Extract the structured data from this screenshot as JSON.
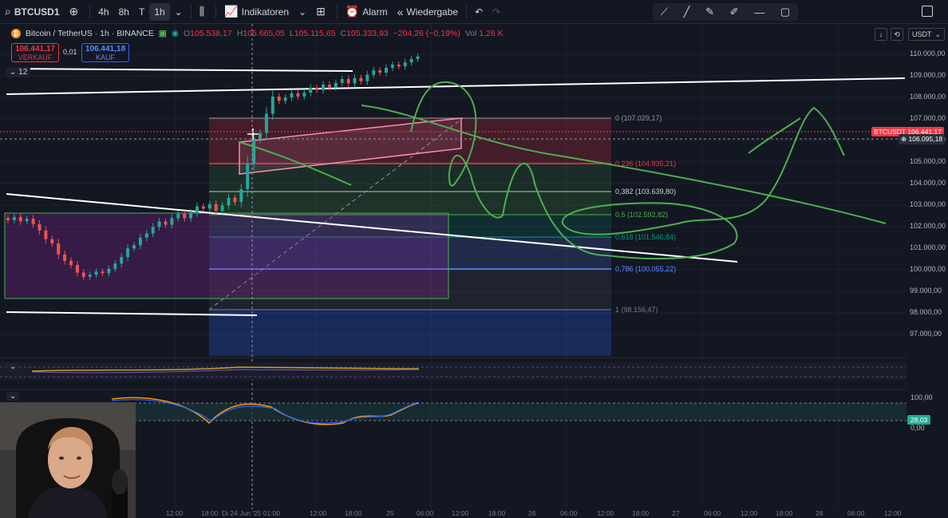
{
  "toolbar": {
    "symbol": "BTCUSD1",
    "intervals": [
      "4h",
      "8h",
      "T",
      "1h"
    ],
    "active_interval": "1h",
    "indicators_label": "Indikatoren",
    "alarm_label": "Alarm",
    "replay_label": "Wiedergabe"
  },
  "legend": {
    "title": "Bitcoin / TetherUS · 1h · BINANCE",
    "o_label": "O",
    "o_value": "105.538,17",
    "h_label": "H",
    "h_value": "105.665,05",
    "l_label": "L",
    "l_value": "105.115,65",
    "c_label": "C",
    "c_value": "105.333,93",
    "change": "−204,26 (−0,19%)",
    "vol_label": "Vol",
    "vol_value": "1,26 K"
  },
  "trade": {
    "sell_price": "106.441,17",
    "sell_label": "VERKAUF",
    "spread": "0,01",
    "buy_price": "106.441,18",
    "buy_label": "KAUF"
  },
  "collapse_count": "12",
  "currency": "USDT",
  "price_axis": [
    "110.000,00",
    "109.000,00",
    "108.000,00",
    "107.000,00",
    "106.000,00",
    "105.000,00",
    "104.000,00",
    "103.000,00",
    "102.000,00",
    "101.000,00",
    "100.000,00",
    "99.000,00",
    "98.000,00",
    "97.000,00"
  ],
  "price_tags": {
    "symbol_tag": "BTCUSDT",
    "last_price": "106.441,17",
    "crosshair_price": "106.095,18"
  },
  "fib": [
    {
      "level": "0",
      "value": "(107.029,17)",
      "color": "#9598a1"
    },
    {
      "level": "0,236",
      "value": "(104.935,21)",
      "color": "#f23645"
    },
    {
      "level": "0,382",
      "value": "(103.639,80)",
      "color": "#d1d4dc"
    },
    {
      "level": "0,5",
      "value": "(102.592,82)",
      "color": "#4caf50"
    },
    {
      "level": "0,618",
      "value": "(101.546,84)",
      "color": "#089981"
    },
    {
      "level": "0,786",
      "value": "(100.055,22)",
      "color": "#5b8cff"
    },
    {
      "level": "1",
      "value": "(98.156,47)",
      "color": "#787b86"
    }
  ],
  "oscillator": {
    "axis_top": "100,00",
    "axis_bottom": "0,00",
    "value": "28,03"
  },
  "time_axis": [
    "12:00",
    "18:00",
    "Di 24 Jun '25 01:00",
    "12:00",
    "18:00",
    "25",
    "06:00",
    "12:00",
    "18:00",
    "26",
    "06:00",
    "12:00",
    "18:00",
    "27",
    "06:00",
    "12:00",
    "18:00",
    "28",
    "06:00",
    "12:00"
  ]
}
